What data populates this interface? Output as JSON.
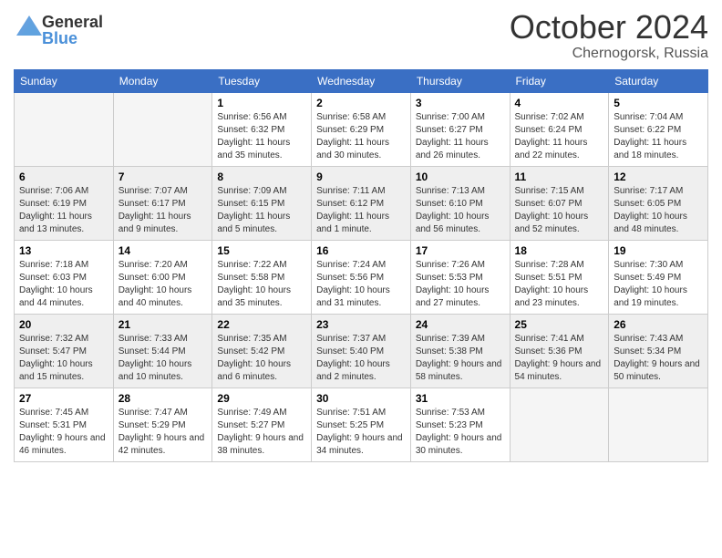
{
  "header": {
    "logo_general": "General",
    "logo_blue": "Blue",
    "month": "October 2024",
    "location": "Chernogorsk, Russia"
  },
  "weekdays": [
    "Sunday",
    "Monday",
    "Tuesday",
    "Wednesday",
    "Thursday",
    "Friday",
    "Saturday"
  ],
  "weeks": [
    [
      {
        "day": null
      },
      {
        "day": null
      },
      {
        "day": "1",
        "sunrise": "Sunrise: 6:56 AM",
        "sunset": "Sunset: 6:32 PM",
        "daylight": "Daylight: 11 hours and 35 minutes."
      },
      {
        "day": "2",
        "sunrise": "Sunrise: 6:58 AM",
        "sunset": "Sunset: 6:29 PM",
        "daylight": "Daylight: 11 hours and 30 minutes."
      },
      {
        "day": "3",
        "sunrise": "Sunrise: 7:00 AM",
        "sunset": "Sunset: 6:27 PM",
        "daylight": "Daylight: 11 hours and 26 minutes."
      },
      {
        "day": "4",
        "sunrise": "Sunrise: 7:02 AM",
        "sunset": "Sunset: 6:24 PM",
        "daylight": "Daylight: 11 hours and 22 minutes."
      },
      {
        "day": "5",
        "sunrise": "Sunrise: 7:04 AM",
        "sunset": "Sunset: 6:22 PM",
        "daylight": "Daylight: 11 hours and 18 minutes."
      }
    ],
    [
      {
        "day": "6",
        "sunrise": "Sunrise: 7:06 AM",
        "sunset": "Sunset: 6:19 PM",
        "daylight": "Daylight: 11 hours and 13 minutes."
      },
      {
        "day": "7",
        "sunrise": "Sunrise: 7:07 AM",
        "sunset": "Sunset: 6:17 PM",
        "daylight": "Daylight: 11 hours and 9 minutes."
      },
      {
        "day": "8",
        "sunrise": "Sunrise: 7:09 AM",
        "sunset": "Sunset: 6:15 PM",
        "daylight": "Daylight: 11 hours and 5 minutes."
      },
      {
        "day": "9",
        "sunrise": "Sunrise: 7:11 AM",
        "sunset": "Sunset: 6:12 PM",
        "daylight": "Daylight: 11 hours and 1 minute."
      },
      {
        "day": "10",
        "sunrise": "Sunrise: 7:13 AM",
        "sunset": "Sunset: 6:10 PM",
        "daylight": "Daylight: 10 hours and 56 minutes."
      },
      {
        "day": "11",
        "sunrise": "Sunrise: 7:15 AM",
        "sunset": "Sunset: 6:07 PM",
        "daylight": "Daylight: 10 hours and 52 minutes."
      },
      {
        "day": "12",
        "sunrise": "Sunrise: 7:17 AM",
        "sunset": "Sunset: 6:05 PM",
        "daylight": "Daylight: 10 hours and 48 minutes."
      }
    ],
    [
      {
        "day": "13",
        "sunrise": "Sunrise: 7:18 AM",
        "sunset": "Sunset: 6:03 PM",
        "daylight": "Daylight: 10 hours and 44 minutes."
      },
      {
        "day": "14",
        "sunrise": "Sunrise: 7:20 AM",
        "sunset": "Sunset: 6:00 PM",
        "daylight": "Daylight: 10 hours and 40 minutes."
      },
      {
        "day": "15",
        "sunrise": "Sunrise: 7:22 AM",
        "sunset": "Sunset: 5:58 PM",
        "daylight": "Daylight: 10 hours and 35 minutes."
      },
      {
        "day": "16",
        "sunrise": "Sunrise: 7:24 AM",
        "sunset": "Sunset: 5:56 PM",
        "daylight": "Daylight: 10 hours and 31 minutes."
      },
      {
        "day": "17",
        "sunrise": "Sunrise: 7:26 AM",
        "sunset": "Sunset: 5:53 PM",
        "daylight": "Daylight: 10 hours and 27 minutes."
      },
      {
        "day": "18",
        "sunrise": "Sunrise: 7:28 AM",
        "sunset": "Sunset: 5:51 PM",
        "daylight": "Daylight: 10 hours and 23 minutes."
      },
      {
        "day": "19",
        "sunrise": "Sunrise: 7:30 AM",
        "sunset": "Sunset: 5:49 PM",
        "daylight": "Daylight: 10 hours and 19 minutes."
      }
    ],
    [
      {
        "day": "20",
        "sunrise": "Sunrise: 7:32 AM",
        "sunset": "Sunset: 5:47 PM",
        "daylight": "Daylight: 10 hours and 15 minutes."
      },
      {
        "day": "21",
        "sunrise": "Sunrise: 7:33 AM",
        "sunset": "Sunset: 5:44 PM",
        "daylight": "Daylight: 10 hours and 10 minutes."
      },
      {
        "day": "22",
        "sunrise": "Sunrise: 7:35 AM",
        "sunset": "Sunset: 5:42 PM",
        "daylight": "Daylight: 10 hours and 6 minutes."
      },
      {
        "day": "23",
        "sunrise": "Sunrise: 7:37 AM",
        "sunset": "Sunset: 5:40 PM",
        "daylight": "Daylight: 10 hours and 2 minutes."
      },
      {
        "day": "24",
        "sunrise": "Sunrise: 7:39 AM",
        "sunset": "Sunset: 5:38 PM",
        "daylight": "Daylight: 9 hours and 58 minutes."
      },
      {
        "day": "25",
        "sunrise": "Sunrise: 7:41 AM",
        "sunset": "Sunset: 5:36 PM",
        "daylight": "Daylight: 9 hours and 54 minutes."
      },
      {
        "day": "26",
        "sunrise": "Sunrise: 7:43 AM",
        "sunset": "Sunset: 5:34 PM",
        "daylight": "Daylight: 9 hours and 50 minutes."
      }
    ],
    [
      {
        "day": "27",
        "sunrise": "Sunrise: 7:45 AM",
        "sunset": "Sunset: 5:31 PM",
        "daylight": "Daylight: 9 hours and 46 minutes."
      },
      {
        "day": "28",
        "sunrise": "Sunrise: 7:47 AM",
        "sunset": "Sunset: 5:29 PM",
        "daylight": "Daylight: 9 hours and 42 minutes."
      },
      {
        "day": "29",
        "sunrise": "Sunrise: 7:49 AM",
        "sunset": "Sunset: 5:27 PM",
        "daylight": "Daylight: 9 hours and 38 minutes."
      },
      {
        "day": "30",
        "sunrise": "Sunrise: 7:51 AM",
        "sunset": "Sunset: 5:25 PM",
        "daylight": "Daylight: 9 hours and 34 minutes."
      },
      {
        "day": "31",
        "sunrise": "Sunrise: 7:53 AM",
        "sunset": "Sunset: 5:23 PM",
        "daylight": "Daylight: 9 hours and 30 minutes."
      },
      {
        "day": null
      },
      {
        "day": null
      }
    ]
  ]
}
